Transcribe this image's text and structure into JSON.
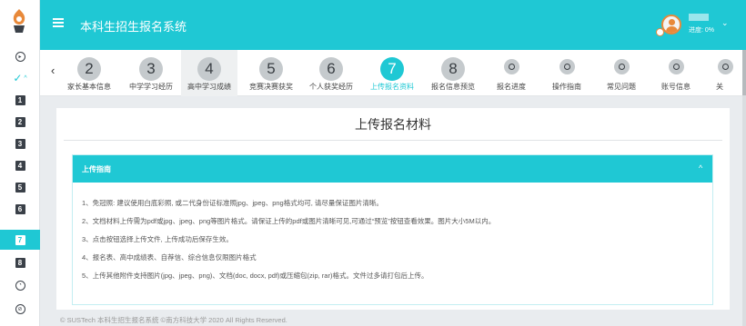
{
  "header": {
    "app_title": "本科生招生报名系统",
    "progress_text": "进度: 0%",
    "user_name": ""
  },
  "sidebar": {
    "items": [
      {
        "kind": "circle-play",
        "label": ""
      },
      {
        "kind": "check",
        "label": ""
      },
      {
        "kind": "number",
        "label": "1"
      },
      {
        "kind": "number",
        "label": "2"
      },
      {
        "kind": "number",
        "label": "3"
      },
      {
        "kind": "number",
        "label": "4"
      },
      {
        "kind": "number",
        "label": "5"
      },
      {
        "kind": "number",
        "label": "6"
      },
      {
        "kind": "number",
        "label": "7",
        "active": true
      },
      {
        "kind": "number",
        "label": "8"
      },
      {
        "kind": "gauge",
        "label": ""
      },
      {
        "kind": "circle",
        "label": ""
      }
    ]
  },
  "steps": [
    {
      "num": "2",
      "label": "家长基本信息"
    },
    {
      "num": "3",
      "label": "中学学习经历"
    },
    {
      "num": "4",
      "label": "高中学习成绩"
    },
    {
      "num": "5",
      "label": "竞赛决赛获奖"
    },
    {
      "num": "6",
      "label": "个人获奖经历"
    },
    {
      "num": "7",
      "label": "上传报名资料"
    },
    {
      "num": "8",
      "label": "报名信息预览"
    },
    {
      "num": "",
      "label": "报名进度"
    },
    {
      "num": "",
      "label": "操作指南"
    },
    {
      "num": "",
      "label": "常见问题"
    },
    {
      "num": "",
      "label": "账号信息"
    },
    {
      "num": "",
      "label": "关"
    }
  ],
  "panel": {
    "title": "上传报名材料",
    "guide_title": "上传指南",
    "items": [
      "1、免冠照: 建议使用白底彩照, 或二代身份证标准照jpg、jpeg、png格式均可, 请尽量保证图片清晰。",
      "2、文档材料上传需为pdf或jpg、jpeg、png等图片格式。请保证上传的pdf或图片清晰可见,可通过“预览”按钮查看效果。图片大小5M以内。",
      "3、点击按钮选择上传文件, 上传成功后保存生效。",
      "4、报名表、高中成绩表、自荐信、综合信息仅限图片格式",
      "5、上传其他附件支持图片(jpg、jpeg、png)、文档(doc, docx, pdf)或压缩包(zip, rar)格式。文件过多请打包后上传。"
    ]
  },
  "footer": {
    "text": "© SUSTech 本科生招生报名系统 ©南方科技大学 2020 All Rights Reserved."
  },
  "colors": {
    "accent": "#1fc8d4",
    "step_inactive": "#c5cacd",
    "avatar_ring": "#e8893a"
  }
}
